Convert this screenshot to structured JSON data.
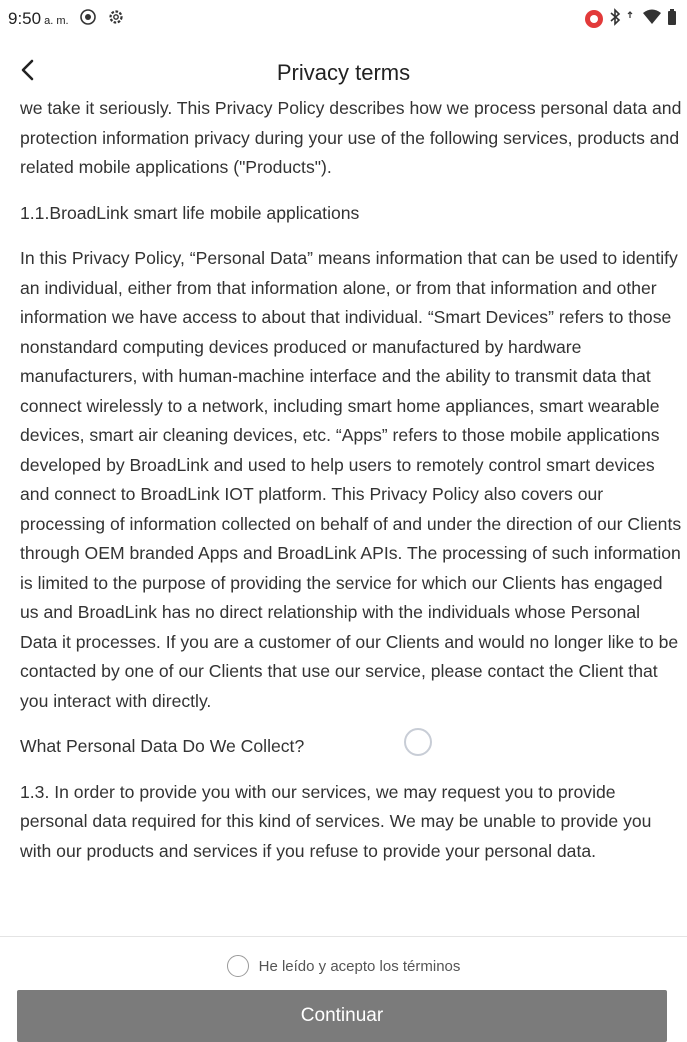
{
  "status_bar": {
    "time": "9:50",
    "ampm": "a. m."
  },
  "header": {
    "title": "Privacy terms"
  },
  "content": {
    "paragraphs": [
      "we take it seriously. This Privacy Policy describes how we process personal data and protection information privacy during your use of the following services, products and related mobile applications (\"Products\").",
      "1.1.BroadLink smart life mobile applications",
      "In this Privacy Policy, “Personal Data” means information that can be used to identify an individual, either from that information alone, or from that information and other information we have access to about that individual. “Smart Devices” refers to those nonstandard computing devices produced or manufactured by hardware manufacturers, with human-machine interface and the ability to transmit data that connect wirelessly to a network, including smart home appliances, smart wearable devices, smart air cleaning devices, etc. “Apps” refers to those mobile applications developed by BroadLink and used to help users to remotely control smart devices and connect to BroadLink IOT platform. This Privacy Policy also covers our processing of information collected on behalf of and under the direction of our Clients through OEM branded Apps and BroadLink APIs. The processing of such information is limited to the purpose of providing the service for which our Clients has engaged us and BroadLink has no direct relationship with the individuals whose Personal Data it processes. If you are a customer of our Clients and would no longer like to be contacted by one of our Clients that use our service, please contact the Client that you interact with directly.",
      "What Personal Data Do We Collect?",
      "1.3. In order to provide you with our services, we may request you to provide personal data required for this kind of services. We may be unable to provide you with our products and services if you refuse to provide your personal data."
    ]
  },
  "footer": {
    "agree_label": "He leído y acepto los términos",
    "agree_checked": false,
    "continue_label": "Continuar"
  },
  "icons": {
    "back": "chevron-left-icon",
    "status_left": [
      "location-icon",
      "settings-icon"
    ],
    "status_right": [
      "screen-record-icon",
      "bluetooth-icon",
      "wifi-icon",
      "battery-icon"
    ]
  },
  "colors": {
    "continue_button_bg": "#7b7b7b",
    "continue_button_text": "#ffffff",
    "record_icon": "#e23a3a"
  }
}
